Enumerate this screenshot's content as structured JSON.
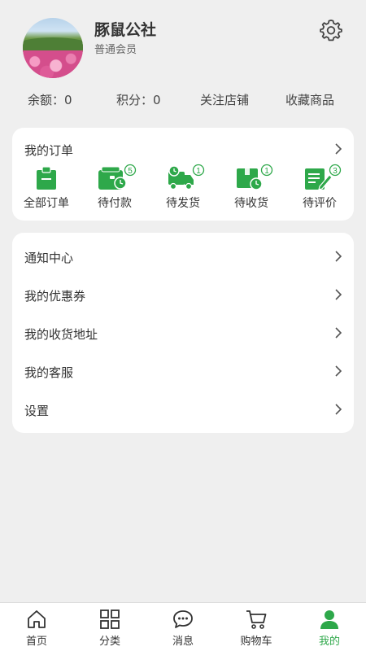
{
  "profile": {
    "name": "豚鼠公社",
    "level": "普通会员",
    "avatar_icon": "avatar-flower-field"
  },
  "stats": {
    "balance": "余额：0",
    "points": "积分：0",
    "followed_shops": "关注店铺",
    "favorites": "收藏商品"
  },
  "orders": {
    "title": "我的订单",
    "items": [
      {
        "label": "全部订单",
        "icon": "clipboard-icon",
        "badge": ""
      },
      {
        "label": "待付款",
        "icon": "wallet-clock-icon",
        "badge": "5"
      },
      {
        "label": "待发货",
        "icon": "truck-icon",
        "badge": "1"
      },
      {
        "label": "待收货",
        "icon": "package-clock-icon",
        "badge": "1"
      },
      {
        "label": "待评价",
        "icon": "review-pen-icon",
        "badge": "3"
      }
    ]
  },
  "menu": [
    {
      "label": "通知中心"
    },
    {
      "label": "我的优惠券"
    },
    {
      "label": "我的收货地址"
    },
    {
      "label": "我的客服"
    },
    {
      "label": "设置"
    }
  ],
  "tabs": [
    {
      "label": "首页",
      "icon": "home-icon"
    },
    {
      "label": "分类",
      "icon": "grid-icon"
    },
    {
      "label": "消息",
      "icon": "chat-icon"
    },
    {
      "label": "购物车",
      "icon": "cart-icon"
    },
    {
      "label": "我的",
      "icon": "user-icon",
      "active": true
    }
  ],
  "colors": {
    "accent": "#2ea84a",
    "background": "#efefef",
    "card": "#ffffff"
  }
}
